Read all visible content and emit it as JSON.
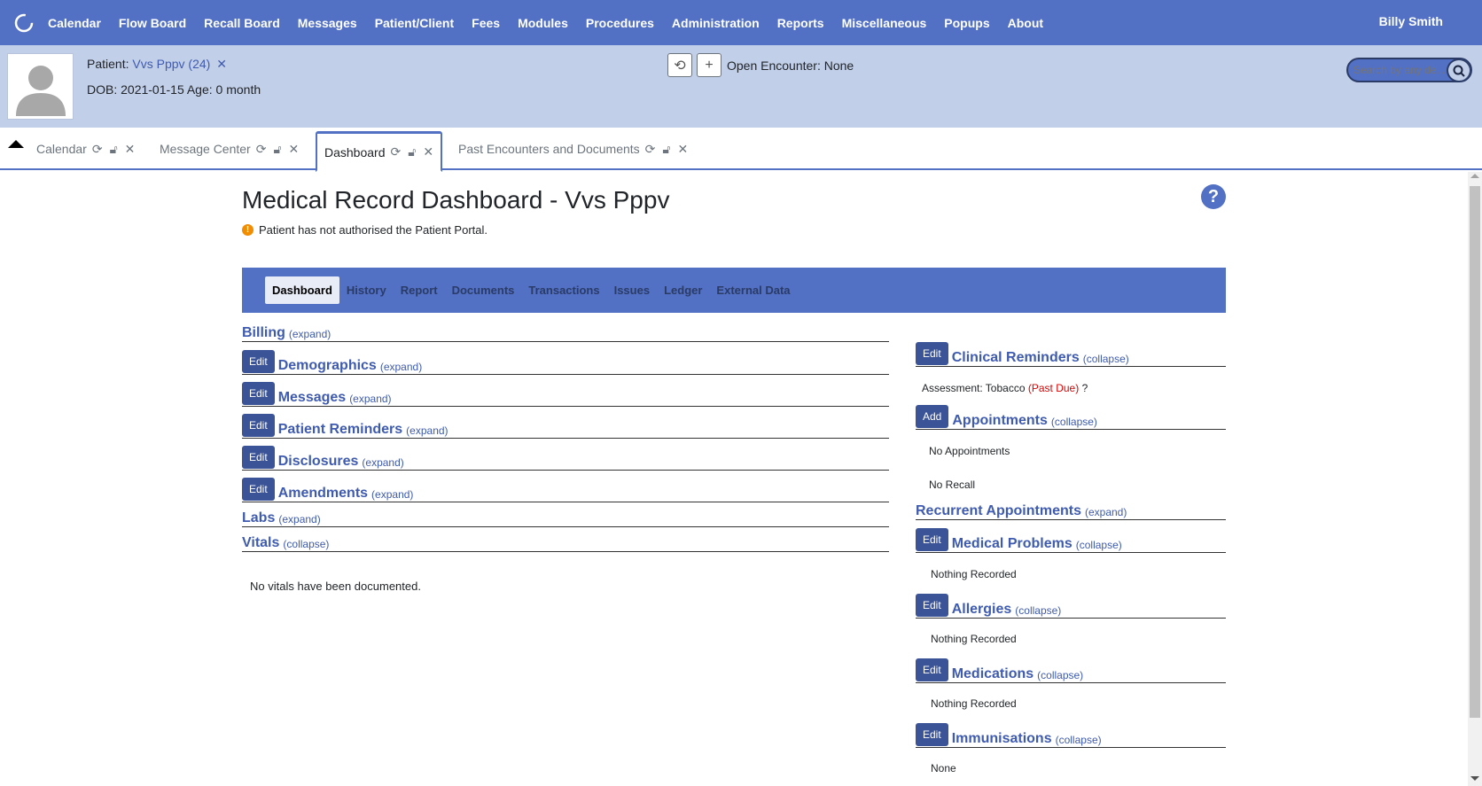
{
  "topnav": {
    "items": [
      "Calendar",
      "Flow Board",
      "Recall Board",
      "Messages",
      "Patient/Client",
      "Fees",
      "Modules",
      "Procedures",
      "Administration",
      "Reports",
      "Miscellaneous",
      "Popups",
      "About"
    ],
    "user": "Billy Smith"
  },
  "patient": {
    "label": "Patient:",
    "name": "Vvs Pppv (24)",
    "dob_line": "DOB: 2021-01-15 Age: 0 month",
    "open_encounter": "Open Encounter: None",
    "search_placeholder": "Search by any de..."
  },
  "tabs": [
    {
      "label": "Calendar"
    },
    {
      "label": "Message Center"
    },
    {
      "label": "Dashboard"
    },
    {
      "label": "Past Encounters and Documents"
    }
  ],
  "page": {
    "title": "Medical Record Dashboard - Vvs Pppv",
    "portal_note": "Patient has not authorised the Patient Portal.",
    "help": "?"
  },
  "subnav": [
    "Dashboard",
    "History",
    "Report",
    "Documents",
    "Transactions",
    "Issues",
    "Ledger",
    "External Data"
  ],
  "left_sections": {
    "billing": {
      "title": "Billing",
      "toggle": "(expand)"
    },
    "demographics": {
      "btn": "Edit",
      "title": "Demographics",
      "toggle": "(expand)"
    },
    "messages": {
      "btn": "Edit",
      "title": "Messages",
      "toggle": "(expand)"
    },
    "reminders": {
      "btn": "Edit",
      "title": "Patient Reminders",
      "toggle": "(expand)"
    },
    "disclosures": {
      "btn": "Edit",
      "title": "Disclosures",
      "toggle": "(expand)"
    },
    "amendments": {
      "btn": "Edit",
      "title": "Amendments",
      "toggle": "(expand)"
    },
    "labs": {
      "title": "Labs",
      "toggle": "(expand)"
    },
    "vitals": {
      "title": "Vitals",
      "toggle": "(collapse)",
      "body": "No vitals have been documented."
    }
  },
  "right_sections": {
    "clinical": {
      "btn": "Edit",
      "title": "Clinical Reminders",
      "toggle": "(collapse)",
      "body_prefix": "Assessment: Tobacco",
      "body_status": "(Past Due)",
      "body_suffix": "?"
    },
    "appointments": {
      "btn": "Add",
      "title": "Appointments",
      "toggle": "(collapse)",
      "body1": "No Appointments",
      "body2": "No Recall"
    },
    "recurrent": {
      "title": "Recurrent Appointments",
      "toggle": "(expand)"
    },
    "problems": {
      "btn": "Edit",
      "title": "Medical Problems",
      "toggle": "(collapse)",
      "body": "Nothing Recorded"
    },
    "allergies": {
      "btn": "Edit",
      "title": "Allergies",
      "toggle": "(collapse)",
      "body": "Nothing Recorded"
    },
    "medications": {
      "btn": "Edit",
      "title": "Medications",
      "toggle": "(collapse)",
      "body": "Nothing Recorded"
    },
    "immunisations": {
      "btn": "Edit",
      "title": "Immunisations",
      "toggle": "(collapse)",
      "body": "None"
    }
  },
  "colors": {
    "brand": "#5270c4",
    "header_bg": "#c2cfe9",
    "button": "#3b5498",
    "past_due": "#dd0000"
  }
}
